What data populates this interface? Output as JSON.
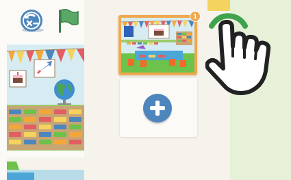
{
  "toolbar": {
    "back_icon": "rewind-x-icon",
    "flag_icon": "green-flag-icon"
  },
  "pages": {
    "items": [
      {
        "number": "1",
        "selected": true
      }
    ],
    "add_icon": "plus-icon"
  },
  "overlay": {
    "hand_icon": "tap-hand-icon"
  },
  "colors": {
    "selected_border": "#f0a84e",
    "add_button": "#4d85bd",
    "flag": "#4c9a5a",
    "hand_ring": "#3fa34d",
    "background": "#e6f1d8"
  }
}
